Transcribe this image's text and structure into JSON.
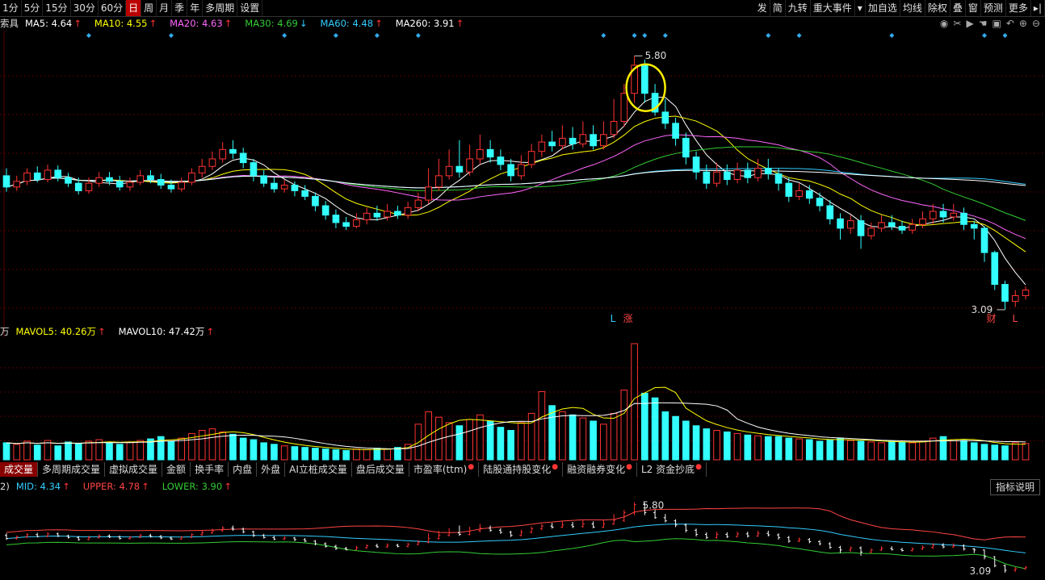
{
  "toolbar": {
    "periods": [
      "1分",
      "5分",
      "15分",
      "30分",
      "60分",
      "日",
      "周",
      "月",
      "季",
      "年",
      "多周期",
      "设置"
    ],
    "active_period": "日",
    "right_items": [
      "发",
      "简",
      "九转",
      "重大事件",
      "▾",
      "加自选",
      "均线",
      "除权",
      "叠",
      "窗",
      "预测",
      "更多",
      "▸|"
    ]
  },
  "main_legend": {
    "prefix": "索具",
    "items": [
      {
        "label": "MA5: 4.64",
        "arrow": "↑",
        "color": "#ffffff"
      },
      {
        "label": "MA10: 4.55",
        "arrow": "↑",
        "color": "#ffff00"
      },
      {
        "label": "MA20: 4.63",
        "arrow": "↑",
        "color": "#ff66ff"
      },
      {
        "label": "MA30: 4.69",
        "arrow": "↓",
        "color": "#33cc33"
      },
      {
        "label": "MA60: 4.48",
        "arrow": "↑",
        "color": "#33ccff"
      },
      {
        "label": "MA260: 3.91",
        "arrow": "↑",
        "color": "#ffffff"
      }
    ]
  },
  "toolbar_icons": [
    "eye-icon",
    "scissors-icon",
    "play-icon",
    "hand-icon",
    "lock-icon",
    "undo-icon",
    "zoom-in-icon",
    "zoom-out-icon"
  ],
  "price_labels": {
    "high": "5.80",
    "low": "3.09"
  },
  "event_markers": [
    {
      "text": "L",
      "color": "#33ccff"
    },
    {
      "text": "涨",
      "color": "#ff4444"
    },
    {
      "text": "财",
      "color": "#ff4444"
    },
    {
      "text": "L",
      "color": "#ff4444"
    }
  ],
  "volume_legend": {
    "prefix": "万",
    "items": [
      {
        "label": "MAVOL5: 40.26万",
        "arrow": "↑",
        "color": "#ffff00"
      },
      {
        "label": "MAVOL10: 47.42万",
        "arrow": "↑",
        "color": "#ffffff"
      }
    ]
  },
  "indicator_tabs": [
    {
      "label": "成交量",
      "active": true,
      "dot": false
    },
    {
      "label": "多周期成交量",
      "active": false,
      "dot": false
    },
    {
      "label": "虚拟成交量",
      "active": false,
      "dot": false
    },
    {
      "label": "金额",
      "active": false,
      "dot": false
    },
    {
      "label": "换手率",
      "active": false,
      "dot": false
    },
    {
      "label": "内盘",
      "active": false,
      "dot": false
    },
    {
      "label": "外盘",
      "active": false,
      "dot": false
    },
    {
      "label": "AI立桩成交量",
      "active": false,
      "dot": false
    },
    {
      "label": "盘后成交量",
      "active": false,
      "dot": false
    },
    {
      "label": "市盈率(ttm)",
      "active": false,
      "dot": true
    },
    {
      "label": "陆股通持股变化",
      "active": false,
      "dot": true
    },
    {
      "label": "融资融券变化",
      "active": false,
      "dot": true
    },
    {
      "label": "L2 资金抄底",
      "active": false,
      "dot": true
    }
  ],
  "boll_legend": {
    "prefix": "2)",
    "items": [
      {
        "label": "MID: 4.34",
        "arrow": "↑",
        "color": "#33ccff"
      },
      {
        "label": "UPPER: 4.78",
        "arrow": "↑",
        "color": "#ff4444"
      },
      {
        "label": "LOWER: 3.90",
        "arrow": "↑",
        "color": "#33cc33"
      }
    ]
  },
  "help_button": "指标说明",
  "chart_data": {
    "type": "candlestick",
    "title": "",
    "price_range": [
      2.9,
      6.0
    ],
    "candles": [
      [
        4.52,
        4.4,
        4.6,
        4.35
      ],
      [
        4.4,
        4.46,
        4.52,
        4.36
      ],
      [
        4.46,
        4.55,
        4.6,
        4.42
      ],
      [
        4.55,
        4.48,
        4.62,
        4.45
      ],
      [
        4.48,
        4.58,
        4.64,
        4.45
      ],
      [
        4.58,
        4.5,
        4.63,
        4.46
      ],
      [
        4.5,
        4.44,
        4.55,
        4.4
      ],
      [
        4.44,
        4.36,
        4.5,
        4.32
      ],
      [
        4.36,
        4.44,
        4.5,
        4.33
      ],
      [
        4.44,
        4.5,
        4.56,
        4.4
      ],
      [
        4.5,
        4.46,
        4.56,
        4.42
      ],
      [
        4.46,
        4.4,
        4.52,
        4.36
      ],
      [
        4.4,
        4.45,
        4.5,
        4.36
      ],
      [
        4.45,
        4.52,
        4.58,
        4.42
      ],
      [
        4.52,
        4.48,
        4.58,
        4.44
      ],
      [
        4.48,
        4.42,
        4.54,
        4.38
      ],
      [
        4.42,
        4.38,
        4.48,
        4.34
      ],
      [
        4.38,
        4.45,
        4.5,
        4.35
      ],
      [
        4.45,
        4.55,
        4.6,
        4.42
      ],
      [
        4.55,
        4.62,
        4.7,
        4.5
      ],
      [
        4.62,
        4.7,
        4.78,
        4.58
      ],
      [
        4.7,
        4.8,
        4.88,
        4.66
      ],
      [
        4.8,
        4.76,
        4.9,
        4.7
      ],
      [
        4.76,
        4.66,
        4.82,
        4.6
      ],
      [
        4.66,
        4.52,
        4.7,
        4.46
      ],
      [
        4.52,
        4.44,
        4.58,
        4.4
      ],
      [
        4.44,
        4.38,
        4.5,
        4.34
      ],
      [
        4.38,
        4.42,
        4.48,
        4.34
      ],
      [
        4.42,
        4.36,
        4.46,
        4.3
      ],
      [
        4.36,
        4.3,
        4.42,
        4.26
      ],
      [
        4.3,
        4.2,
        4.34,
        4.14
      ],
      [
        4.2,
        4.1,
        4.25,
        4.05
      ],
      [
        4.1,
        4.02,
        4.16,
        3.96
      ],
      [
        4.02,
        3.98,
        4.08,
        3.94
      ],
      [
        3.98,
        4.05,
        4.12,
        3.96
      ],
      [
        4.05,
        4.12,
        4.18,
        4.0
      ],
      [
        4.12,
        4.08,
        4.2,
        4.04
      ],
      [
        4.08,
        4.14,
        4.22,
        4.04
      ],
      [
        4.14,
        4.1,
        4.2,
        4.06
      ],
      [
        4.1,
        4.18,
        4.24,
        4.06
      ],
      [
        4.18,
        4.26,
        4.34,
        4.14
      ],
      [
        4.26,
        4.4,
        4.6,
        4.22
      ],
      [
        4.4,
        4.52,
        4.7,
        4.36
      ],
      [
        4.52,
        4.62,
        4.8,
        4.48
      ],
      [
        4.62,
        4.56,
        4.9,
        4.5
      ],
      [
        4.56,
        4.7,
        4.85,
        4.52
      ],
      [
        4.7,
        4.8,
        4.96,
        4.64
      ],
      [
        4.8,
        4.72,
        4.9,
        4.66
      ],
      [
        4.72,
        4.64,
        4.8,
        4.58
      ],
      [
        4.64,
        4.52,
        4.7,
        4.46
      ],
      [
        4.52,
        4.64,
        4.74,
        4.48
      ],
      [
        4.64,
        4.78,
        4.86,
        4.6
      ],
      [
        4.78,
        4.88,
        4.96,
        4.72
      ],
      [
        4.88,
        4.84,
        5.0,
        4.78
      ],
      [
        4.84,
        4.92,
        5.06,
        4.8
      ],
      [
        4.92,
        4.86,
        5.04,
        4.8
      ],
      [
        4.86,
        4.96,
        5.1,
        4.82
      ],
      [
        4.96,
        4.84,
        5.06,
        4.8
      ],
      [
        4.84,
        4.96,
        5.1,
        4.8
      ],
      [
        4.96,
        5.1,
        5.34,
        4.92
      ],
      [
        5.1,
        5.4,
        5.5,
        5.04
      ],
      [
        5.4,
        5.7,
        5.8,
        5.3
      ],
      [
        5.7,
        5.4,
        5.76,
        5.3
      ],
      [
        5.4,
        5.2,
        5.5,
        5.16
      ],
      [
        5.2,
        5.08,
        5.34,
        5.02
      ],
      [
        5.08,
        4.92,
        5.14,
        4.84
      ],
      [
        4.92,
        4.72,
        4.98,
        4.64
      ],
      [
        4.72,
        4.56,
        4.78,
        4.48
      ],
      [
        4.56,
        4.44,
        4.64,
        4.38
      ],
      [
        4.44,
        4.56,
        4.66,
        4.4
      ],
      [
        4.56,
        4.48,
        4.64,
        4.42
      ],
      [
        4.48,
        4.58,
        4.66,
        4.44
      ],
      [
        4.58,
        4.5,
        4.66,
        4.44
      ],
      [
        4.5,
        4.6,
        4.7,
        4.46
      ],
      [
        4.6,
        4.54,
        4.7,
        4.48
      ],
      [
        4.54,
        4.44,
        4.6,
        4.36
      ],
      [
        4.44,
        4.3,
        4.5,
        4.24
      ],
      [
        4.3,
        4.36,
        4.44,
        4.26
      ],
      [
        4.36,
        4.28,
        4.42,
        4.22
      ],
      [
        4.28,
        4.2,
        4.34,
        4.14
      ],
      [
        4.2,
        4.06,
        4.26,
        4.0
      ],
      [
        4.06,
        3.96,
        4.12,
        3.84
      ],
      [
        3.96,
        4.04,
        4.1,
        3.9
      ],
      [
        4.04,
        3.88,
        4.1,
        3.74
      ],
      [
        3.88,
        3.96,
        4.02,
        3.84
      ],
      [
        3.96,
        4.02,
        4.1,
        3.92
      ],
      [
        4.02,
        3.98,
        4.1,
        3.94
      ],
      [
        3.98,
        3.94,
        4.04,
        3.9
      ],
      [
        3.94,
        4.0,
        4.06,
        3.9
      ],
      [
        4.0,
        4.06,
        4.14,
        3.96
      ],
      [
        4.06,
        4.14,
        4.22,
        4.0
      ],
      [
        4.14,
        4.08,
        4.22,
        4.02
      ],
      [
        4.08,
        4.12,
        4.22,
        4.04
      ],
      [
        4.12,
        4.0,
        4.18,
        3.94
      ],
      [
        4.0,
        3.96,
        4.04,
        3.84
      ],
      [
        3.96,
        3.7,
        3.98,
        3.6
      ],
      [
        3.7,
        3.36,
        3.72,
        3.3
      ],
      [
        3.36,
        3.18,
        3.4,
        3.09
      ],
      [
        3.18,
        3.24,
        3.3,
        3.12
      ],
      [
        3.24,
        3.3,
        3.34,
        3.2
      ]
    ],
    "volume": [
      22,
      20,
      24,
      19,
      25,
      18,
      23,
      21,
      24,
      26,
      22,
      20,
      23,
      25,
      27,
      30,
      24,
      28,
      34,
      38,
      40,
      36,
      33,
      28,
      26,
      22,
      20,
      18,
      17,
      16,
      15,
      14,
      13,
      12,
      14,
      13,
      15,
      14,
      16,
      20,
      46,
      62,
      55,
      48,
      44,
      52,
      58,
      50,
      42,
      38,
      48,
      60,
      88,
      70,
      62,
      58,
      54,
      50,
      46,
      60,
      90,
      150,
      86,
      80,
      62,
      56,
      50,
      44,
      40,
      38,
      36,
      34,
      32,
      31,
      30,
      30,
      28,
      27,
      26,
      24,
      26,
      28,
      25,
      24,
      23,
      22,
      24,
      23,
      22,
      24,
      28,
      30,
      26,
      25,
      22,
      20,
      19,
      18,
      22,
      21
    ],
    "boll": {
      "mid": 4.34,
      "upper": 4.78,
      "lower": 3.9
    }
  }
}
